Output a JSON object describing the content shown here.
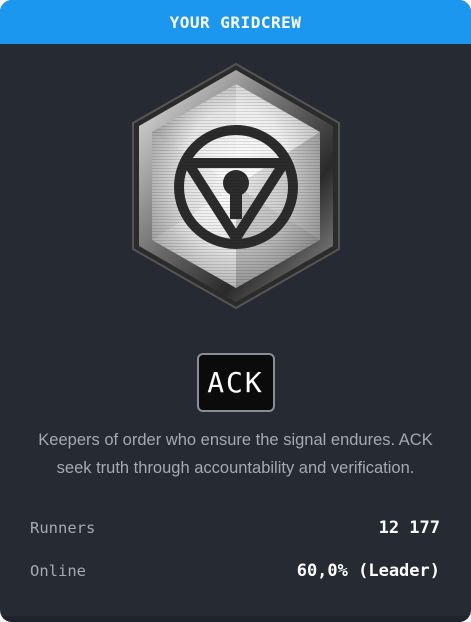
{
  "header": {
    "title": "YOUR GRIDCREW"
  },
  "crew": {
    "tag": "ACK",
    "description": "Keepers of order who ensure the signal endures. ACK seek truth through accountability and verification.",
    "emblem_icon": "triangle-in-circle-hexagon-icon"
  },
  "stats": [
    {
      "label": "Runners",
      "value": "12 177"
    },
    {
      "label": "Online",
      "value": "60,0% (Leader)"
    }
  ],
  "colors": {
    "header_bg": "#1b97f0",
    "card_bg": "#252a33",
    "muted_text": "#a4a9b2"
  }
}
